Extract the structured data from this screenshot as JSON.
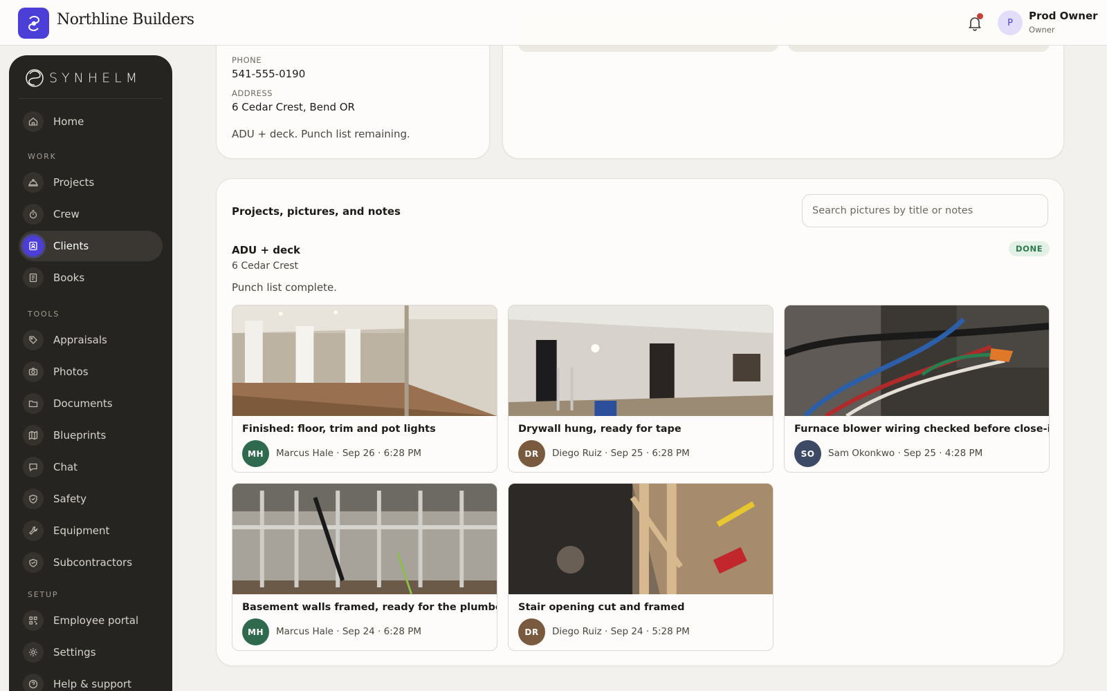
{
  "header": {
    "company_name": "Northline Builders",
    "notifications_icon": "bell-icon",
    "user_initial": "P",
    "user_name": "Prod Owner",
    "user_role": "Owner"
  },
  "sidebar": {
    "logo_text": "SYNHELM",
    "sections": {
      "work": "WORK",
      "tools": "TOOLS",
      "setup": "SETUP"
    },
    "items": [
      {
        "label": "Home",
        "icon": "home-icon"
      },
      {
        "label": "Projects",
        "icon": "hard-hat-icon"
      },
      {
        "label": "Crew",
        "icon": "stopwatch-icon"
      },
      {
        "label": "Clients",
        "icon": "contact-card-icon",
        "active": true
      },
      {
        "label": "Books",
        "icon": "ledger-icon"
      },
      {
        "label": "Appraisals",
        "icon": "tag-icon"
      },
      {
        "label": "Photos",
        "icon": "camera-icon"
      },
      {
        "label": "Documents",
        "icon": "folder-icon"
      },
      {
        "label": "Blueprints",
        "icon": "map-icon"
      },
      {
        "label": "Chat",
        "icon": "chat-bubble-icon"
      },
      {
        "label": "Safety",
        "icon": "shield-icon"
      },
      {
        "label": "Equipment",
        "icon": "wrench-icon"
      },
      {
        "label": "Subcontractors",
        "icon": "handshake-icon"
      },
      {
        "label": "Employee portal",
        "icon": "qr-code-icon"
      },
      {
        "label": "Settings",
        "icon": "gear-icon"
      },
      {
        "label": "Help & support",
        "icon": "help-icon"
      }
    ]
  },
  "client": {
    "phone_label": "PHONE",
    "phone": "541-555-0190",
    "address_label": "ADDRESS",
    "address": "6 Cedar Crest, Bend OR",
    "note": "ADU + deck. Punch list remaining."
  },
  "gallery": {
    "title": "Projects, pictures, and notes",
    "search_placeholder": "Search pictures by title or notes",
    "project": {
      "name": "ADU + deck",
      "address": "6 Cedar Crest",
      "status": "DONE",
      "note": "Punch list complete."
    },
    "photos": [
      {
        "title": "Finished: floor, trim and pot lights",
        "initials": "MH",
        "author": "Marcus Hale",
        "date": "Sep 26",
        "time": "6:28 PM",
        "meta": "Marcus Hale · Sep 26 · 6:28 PM",
        "avatar_color": "#2f6a4f"
      },
      {
        "title": "Drywall hung, ready for tape",
        "initials": "DR",
        "author": "Diego Ruiz",
        "date": "Sep 25",
        "time": "6:28 PM",
        "meta": "Diego Ruiz · Sep 25 · 6:28 PM",
        "avatar_color": "#7a5a3e"
      },
      {
        "title": "Furnace blower wiring checked before close-in",
        "initials": "SO",
        "author": "Sam Okonkwo",
        "date": "Sep 25",
        "time": "4:28 PM",
        "meta": "Sam Okonkwo · Sep 25 · 4:28 PM",
        "avatar_color": "#3d4a66"
      },
      {
        "title": "Basement walls framed, ready for the plumber",
        "initials": "MH",
        "author": "Marcus Hale",
        "date": "Sep 24",
        "time": "6:28 PM",
        "meta": "Marcus Hale · Sep 24 · 6:28 PM",
        "avatar_color": "#2f6a4f"
      },
      {
        "title": "Stair opening cut and framed",
        "initials": "DR",
        "author": "Diego Ruiz",
        "date": "Sep 24",
        "time": "5:28 PM",
        "meta": "Diego Ruiz · Sep 24 · 5:28 PM",
        "avatar_color": "#7a5a3e"
      }
    ]
  },
  "colors": {
    "accent": "#4b3fd8",
    "sidebar_bg": "#262421",
    "page_bg": "#f3f1ed",
    "status_done_bg": "#e2f0e6",
    "status_done_text": "#2d7a4f",
    "notification_dot": "#c2403a"
  }
}
